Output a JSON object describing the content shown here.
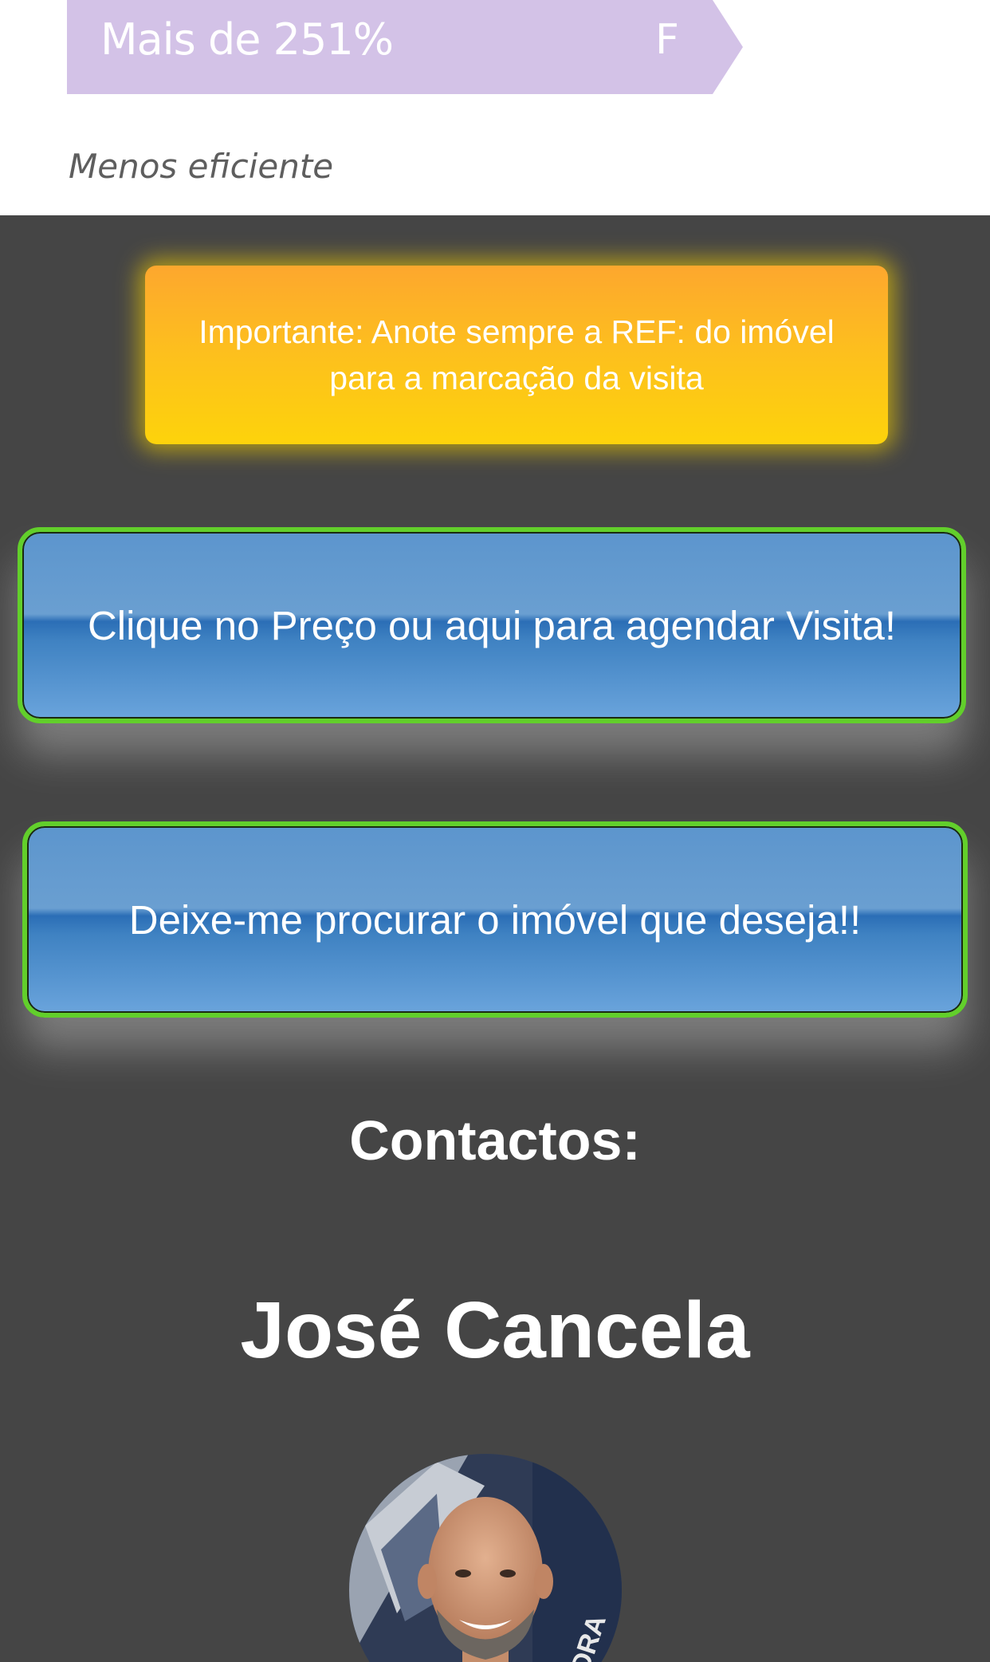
{
  "energy": {
    "range_label": "Mais de 251%",
    "class_letter": "F",
    "caption": "Menos eficiente",
    "bar_color": "#d3c2e7"
  },
  "notice": {
    "text": "Importante: Anote sempre a REF: do imóvel para a marcação da visita",
    "color": "#fdc01d"
  },
  "buttons": {
    "schedule_label": "Clique no Preço ou aqui para agendar Visita!",
    "search_label": "Deixe-me procurar o imóvel que deseja!!",
    "border_color": "#62cf2b",
    "fill_color": "#4a89c8"
  },
  "contacts": {
    "heading": "Contactos:",
    "agent_name": "José Cancela",
    "avatar_icon": "agent-photo",
    "avatar_sign_text": "NDRA"
  },
  "colors": {
    "page_background": "#454545",
    "top_background": "#ffffff"
  }
}
